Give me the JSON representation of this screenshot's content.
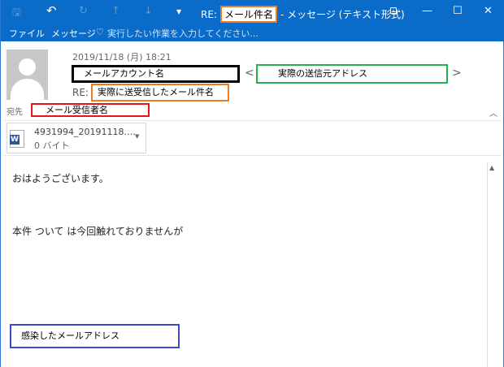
{
  "titlebar": {
    "prefix": "RE:",
    "subject_redacted": "メール件名",
    "suffix": "- メッセージ (テキスト形式)"
  },
  "ribbon": {
    "file": "ファイル",
    "message": "メッセージ",
    "search_placeholder": "実行したい作業を入力してください..."
  },
  "header": {
    "date": "2019/11/18 (月) 18:21",
    "sender_name": "メールアカウント名",
    "sender_address": "実際の送信元アドレス",
    "lt": "<",
    "gt": ">",
    "subject_prefix": "RE:",
    "subject": "実際に送受信したメール件名",
    "to_label": "宛先",
    "to": "メール受信者名"
  },
  "attachment": {
    "name": "4931994_20191118.…",
    "size": "0 バイト"
  },
  "body": {
    "line1": "おはようございます。",
    "line2": "本件 ついて は今回触れておりませんが",
    "infected_address": "感染したメールアドレス"
  },
  "colors": {
    "accent": "#0a6cc8",
    "black_box": "#000000",
    "green_box": "#22b14c",
    "orange_box": "#f07a22",
    "red_box": "#e8141c",
    "blue_box": "#3f48cc"
  }
}
